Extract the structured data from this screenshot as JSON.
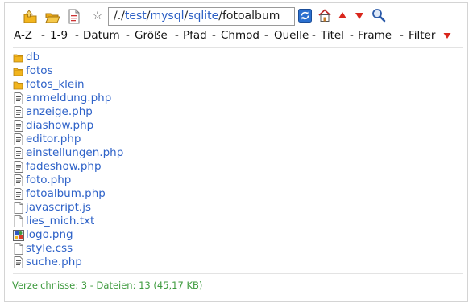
{
  "path": {
    "prefix": "/.",
    "segments": [
      "test",
      "mysql",
      "sqlite",
      "fotoalbum"
    ]
  },
  "toolbar_icons": [
    {
      "name": "folder-up-icon"
    },
    {
      "name": "folder-open-icon"
    },
    {
      "name": "new-file-icon"
    },
    {
      "name": "star-icon"
    }
  ],
  "toolbar_right_icons": [
    {
      "name": "refresh-icon"
    },
    {
      "name": "home-icon"
    },
    {
      "name": "arrow-up-icon"
    },
    {
      "name": "arrow-down-icon"
    },
    {
      "name": "search-icon"
    }
  ],
  "sort_options": [
    {
      "label": "A-Z"
    },
    {
      "label": "1-9"
    },
    {
      "label": "Datum"
    },
    {
      "label": "Größe"
    },
    {
      "label": "Pfad"
    },
    {
      "label": "Chmod"
    },
    {
      "label": "Quelle"
    },
    {
      "label": "Titel"
    },
    {
      "label": "Frame"
    },
    {
      "label": "Filter"
    }
  ],
  "filter_arrow_icon": "triangle-down-icon",
  "files": [
    {
      "name": "db",
      "type": "folder"
    },
    {
      "name": "fotos",
      "type": "folder"
    },
    {
      "name": "fotos_klein",
      "type": "folder"
    },
    {
      "name": "anmeldung.php",
      "type": "php"
    },
    {
      "name": "anzeige.php",
      "type": "php"
    },
    {
      "name": "diashow.php",
      "type": "php"
    },
    {
      "name": "editor.php",
      "type": "php"
    },
    {
      "name": "einstellungen.php",
      "type": "php"
    },
    {
      "name": "fadeshow.php",
      "type": "php"
    },
    {
      "name": "foto.php",
      "type": "php"
    },
    {
      "name": "fotoalbum.php",
      "type": "php"
    },
    {
      "name": "javascript.js",
      "type": "text"
    },
    {
      "name": "lies_mich.txt",
      "type": "text"
    },
    {
      "name": "logo.png",
      "type": "image"
    },
    {
      "name": "style.css",
      "type": "text"
    },
    {
      "name": "suche.php",
      "type": "php"
    }
  ],
  "status": "Verzeichnisse: 3 - Dateien: 13 (45,17 KB)",
  "colors": {
    "link": "#2e62c8",
    "status": "#3d9a3d",
    "arrow_red": "#d9261c",
    "folder_yellow": "#f2b51e"
  }
}
